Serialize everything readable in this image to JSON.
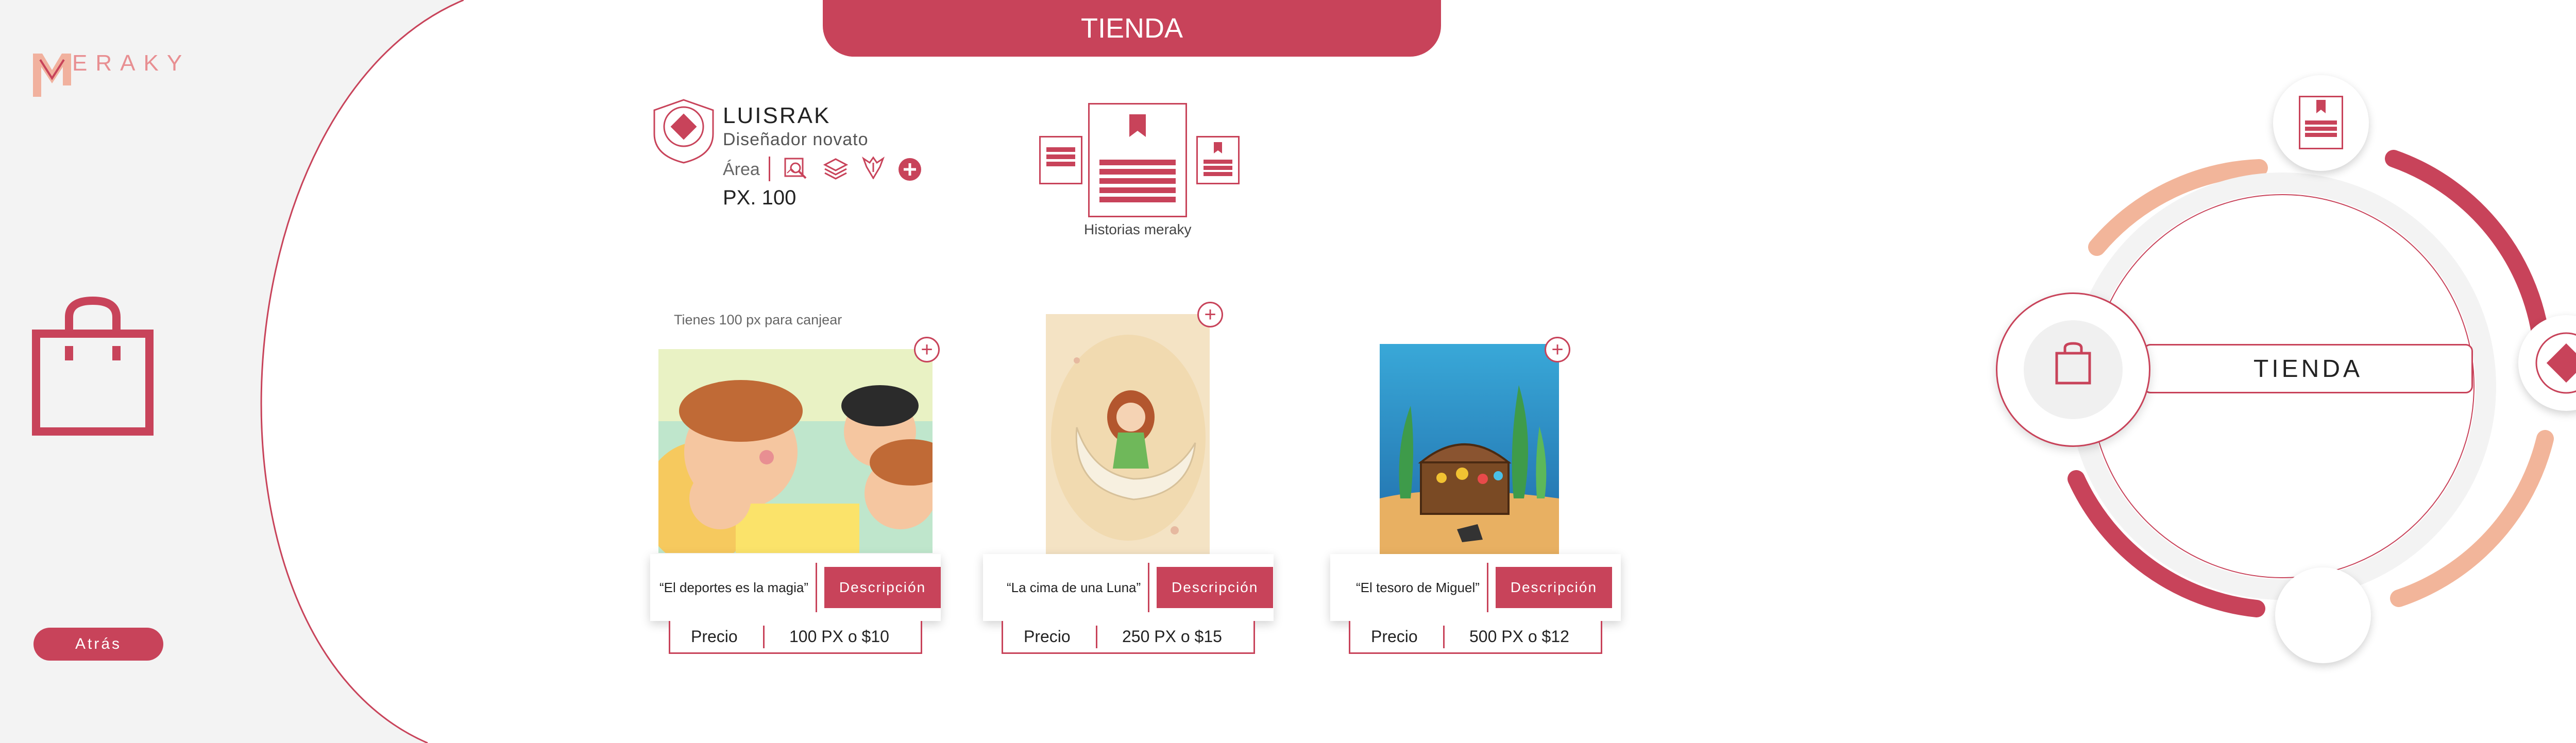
{
  "brand": {
    "logo_text": "ERAKY"
  },
  "nav": {
    "back_label": "Atrás",
    "top_tab_label": "TIENDA"
  },
  "profile": {
    "username": "LUISRAK",
    "subtitle": "Diseñador novato",
    "area_label": "Área",
    "area_icons": [
      "search-image-icon",
      "layers-icon",
      "pen-nib-icon",
      "add-icon"
    ],
    "balance": "PX. 100"
  },
  "stories": {
    "caption": "Historias meraky"
  },
  "shop": {
    "redeem_text": "Tienes 100 px para canjear",
    "price_label": "Precio",
    "description_label": "Descripción",
    "products": [
      {
        "title": "“El deportes es la magia”",
        "price": "100 PX o $10"
      },
      {
        "title": "“La cima de una Luna”",
        "price": "250 PX o $15"
      },
      {
        "title": "“El tesoro de Miguel”",
        "price": "500 PX o $12"
      }
    ]
  },
  "ring_menu": {
    "center_label": "TIENDA"
  },
  "colors": {
    "accent": "#c8435a",
    "peach": "#f2b59a",
    "light_gray": "#f3f3f3"
  }
}
